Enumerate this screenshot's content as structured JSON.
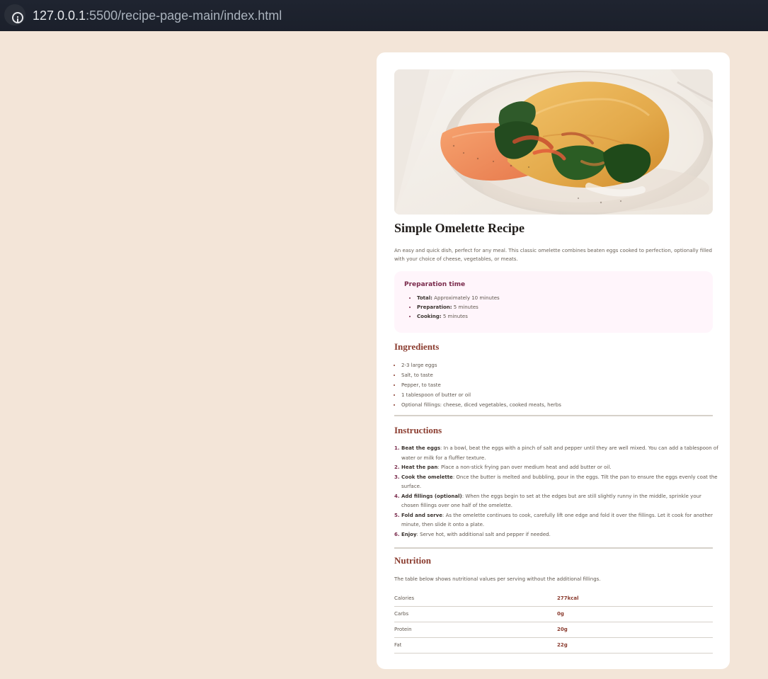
{
  "browser": {
    "url_host": "127.0.0.1",
    "url_path": ":5500/recipe-page-main/index.html",
    "info_icon": "info-icon"
  },
  "card": {
    "title": "Simple Omelette Recipe",
    "intro": "An easy and quick dish, perfect for any meal. This classic omelette combines beaten eggs cooked to perfection, optionally filled with your choice of cheese, vegetables, or meats.",
    "prep": {
      "heading": "Preparation time",
      "items": [
        {
          "label": "Total:",
          "value": " Approximately 10 minutes"
        },
        {
          "label": "Preparation:",
          "value": " 5 minutes"
        },
        {
          "label": "Cooking:",
          "value": " 5 minutes"
        }
      ]
    },
    "ingredients": {
      "heading": "Ingredients",
      "items": [
        "2-3 large eggs",
        "Salt, to taste",
        "Pepper, to taste",
        "1 tablespoon of butter or oil",
        "Optional fillings: cheese, diced vegetables, cooked meats, herbs"
      ]
    },
    "instructions": {
      "heading": "Instructions",
      "items": [
        {
          "label": "Beat the eggs",
          "text": ": In a bowl, beat the eggs with a pinch of salt and pepper until they are well mixed. You can add a tablespoon of water or milk for a fluffier texture."
        },
        {
          "label": "Heat the pan",
          "text": ": Place a non-stick frying pan over medium heat and add butter or oil."
        },
        {
          "label": "Cook the omelette",
          "text": ": Once the butter is melted and bubbling, pour in the eggs. Tilt the pan to ensure the eggs evenly coat the surface."
        },
        {
          "label": "Add fillings (optional)",
          "text": ": When the eggs begin to set at the edges but are still slightly runny in the middle, sprinkle your chosen fillings over one half of the omelette."
        },
        {
          "label": "Fold and serve",
          "text": ": As the omelette continues to cook, carefully lift one edge and fold it over the fillings. Let it cook for another minute, then slide it onto a plate."
        },
        {
          "label": "Enjoy",
          "text": ": Serve hot, with additional salt and pepper if needed."
        }
      ]
    },
    "nutrition": {
      "heading": "Nutrition",
      "desc": "The table below shows nutritional values per serving without the additional fillings.",
      "rows": [
        {
          "k": "Calories",
          "v": "277kcal"
        },
        {
          "k": "Carbs",
          "v": "0g"
        },
        {
          "k": "Protein",
          "v": "20g"
        },
        {
          "k": "Fat",
          "v": "22g"
        }
      ]
    }
  }
}
